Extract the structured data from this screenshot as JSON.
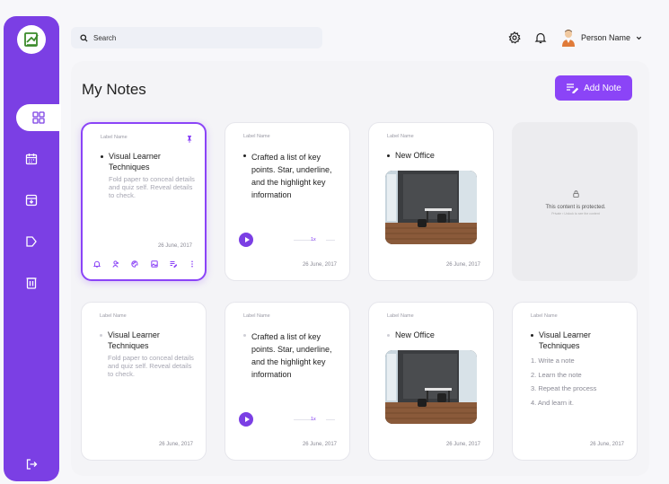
{
  "search": {
    "placeholder": "Search"
  },
  "user": {
    "name": "Person Name"
  },
  "page": {
    "title": "My Notes",
    "add_label": "Add Note"
  },
  "colors": {
    "accent": "#8b44f7",
    "sidebar": "#7b3fe4"
  },
  "sidebar": {
    "items": [
      {
        "icon": "grid-icon",
        "active": true
      },
      {
        "icon": "calendar-icon",
        "active": false
      },
      {
        "icon": "archive-icon",
        "active": false
      },
      {
        "icon": "label-icon",
        "active": false
      },
      {
        "icon": "trash-icon",
        "active": false
      }
    ],
    "logout_icon": "logout-icon"
  },
  "cards": [
    {
      "label": "Label Name",
      "title": "Visual Learner Techniques",
      "body": "Fold paper to conceal details and quiz self. Reveal details to check.",
      "date": "26 June, 2017"
    },
    {
      "label": "Label Name",
      "title": "Crafted a list of key points.  Star, underline, and the highlight key information",
      "speed": "1x",
      "date": "26 June, 2017"
    },
    {
      "label": "Label Name",
      "title": "New Office",
      "date": "26 June, 2017"
    },
    {
      "protected_text": "This content is protected.",
      "protected_sub": "Private ▪ Unlock to see the content"
    },
    {
      "label": "Label Name",
      "title": "Visual Learner Techniques",
      "body": "Fold paper to conceal details and quiz self. Reveal details to check.",
      "date": "26 June, 2017"
    },
    {
      "label": "Label Name",
      "title": "Crafted a list of key points.  Star, underline, and the highlight key information",
      "speed": "1x",
      "date": "26 June, 2017"
    },
    {
      "label": "Label Name",
      "title": "New Office",
      "date": "26 June, 2017"
    },
    {
      "label": "Label Name",
      "title": "Visual Learner Techniques",
      "steps": [
        "1. Write a note",
        "2. Learn the note",
        "3. Repeat the process",
        "4. And learn it."
      ],
      "date": "26 June, 2017"
    }
  ]
}
